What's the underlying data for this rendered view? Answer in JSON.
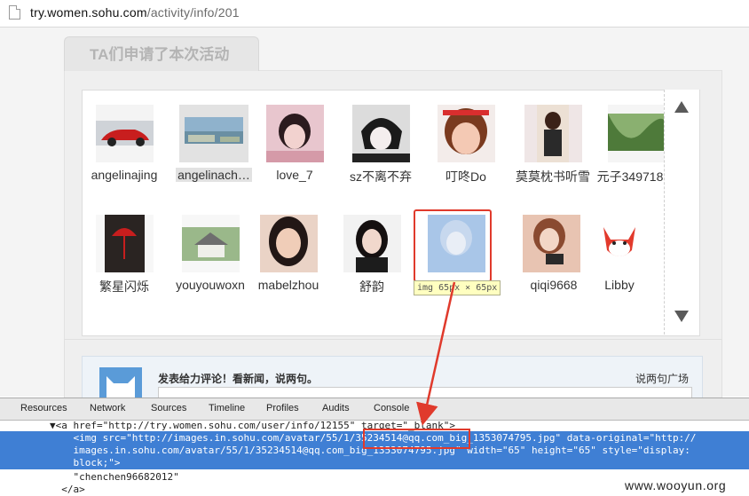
{
  "browser": {
    "url_host": "try.women.sohu.com",
    "url_path": "/activity/info/201"
  },
  "page": {
    "tab_title": "TA们申请了本次活动",
    "users": [
      {
        "name": "angelinajing",
        "icon": "red-sports-car-avatar"
      },
      {
        "name": "angelinach…",
        "icon": "harbor-city-avatar"
      },
      {
        "name": "love_7",
        "icon": "girl-pink-avatar"
      },
      {
        "name": "sz不离不弃",
        "icon": "anime-boy-avatar"
      },
      {
        "name": "叮咚Do",
        "icon": "girl-closeup-avatar"
      },
      {
        "name": "莫莫枕书听雪",
        "icon": "girl-standing-avatar"
      },
      {
        "name": "元子349718…",
        "icon": "green-abstract-avatar"
      },
      {
        "name": "繁星闪烁",
        "icon": "red-umbrella-avatar"
      },
      {
        "name": "youyouwoxn",
        "icon": "house-avatar"
      },
      {
        "name": "mabelzhou",
        "icon": "girl-longhair-avatar"
      },
      {
        "name": "舒韵",
        "icon": "girl-dark-avatar"
      },
      {
        "name": "chenchen96682012",
        "icon": "girl-blue-avatar"
      },
      {
        "name": "qiqi9668",
        "icon": "girl-camera-avatar"
      },
      {
        "name": "Libby",
        "icon": "cartoon-fox-avatar"
      }
    ],
    "tooltip": "img 65px × 65px",
    "comment_title": "发表给力评论！看新闻，说两句。",
    "comment_link": "说两句广场"
  },
  "devtools": {
    "tabs": [
      "Resources",
      "Network",
      "Sources",
      "Timeline",
      "Profiles",
      "Audits",
      "Console"
    ],
    "line1": "▼<a href=\"http://try.women.sohu.com/user/info/12155\" target=\"_blank\">",
    "line2": "    <img src=\"http://images.in.sohu.com/avatar/55/1/35234514@qq.com_big_1353074795.jpg\" data-original=\"http://",
    "line3": "    images.in.sohu.com/avatar/55/1/35234514@qq.com_big_1353074795.jpg\" width=\"65\" height=\"65\" style=\"display:",
    "line4": "    block;\">",
    "line5": "    \"chenchen96682012\"",
    "line6": "  </a>"
  },
  "watermark": "www.wooyun.org",
  "colors": {
    "highlight_red": "#e03a2c",
    "devtools_selection": "#3f7fd4",
    "panel_bg": "#efefef"
  }
}
